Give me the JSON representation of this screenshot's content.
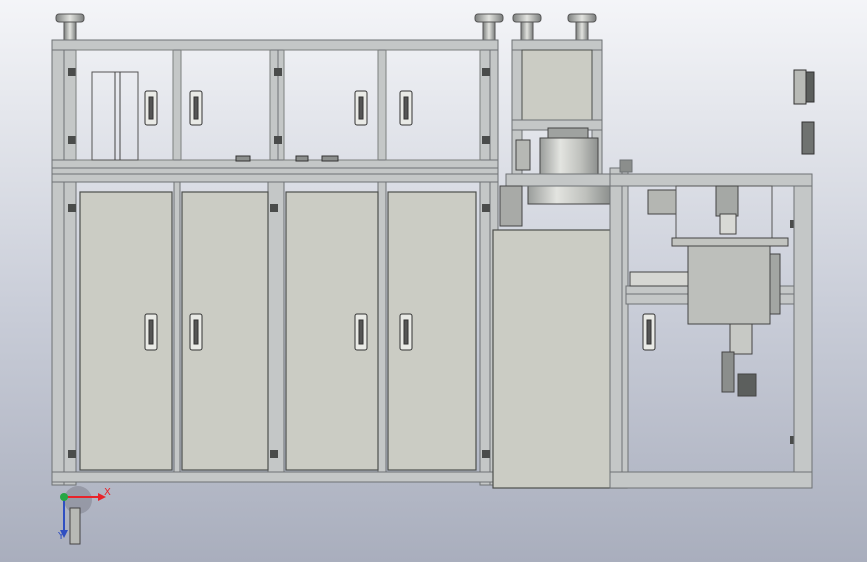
{
  "viewport": {
    "background_top": "#f4f5f8",
    "background_bottom": "#a9aebd"
  },
  "colors": {
    "frame": "#c4c7c7",
    "frame_dark": "#6e7274",
    "panel": "#cbccc4",
    "panel_edge": "#4d4f4c",
    "axis_x": "#e8232a",
    "axis_y": "#2f4fc2",
    "axis_z": "#28a745"
  },
  "triad": {
    "x_label": "X",
    "y_label": "Y"
  },
  "icons": {
    "triad": "coordinate-triad-icon",
    "handle": "door-handle-icon",
    "foot": "leveling-foot-icon"
  }
}
